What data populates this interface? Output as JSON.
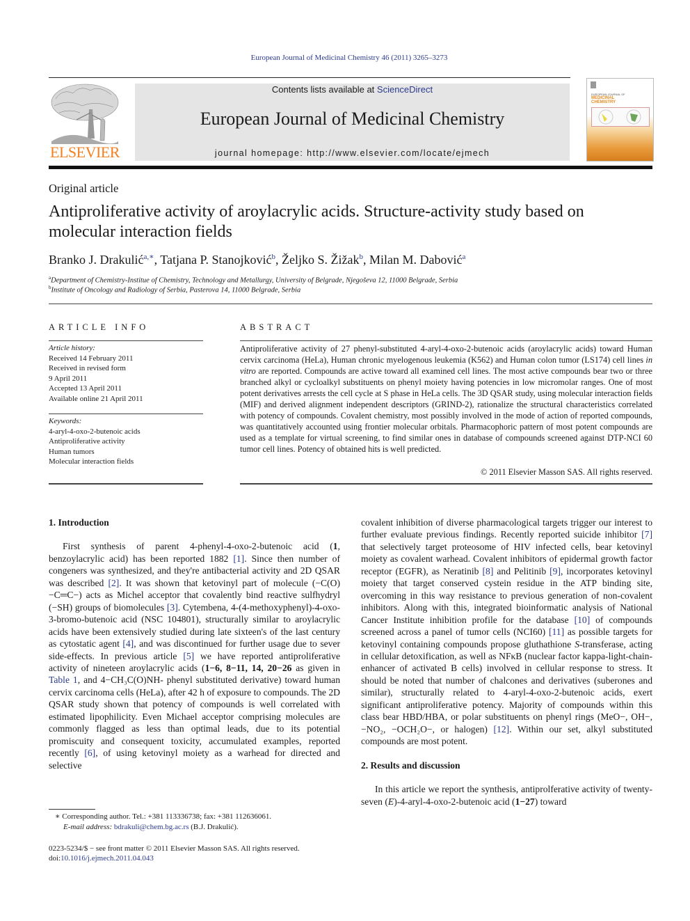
{
  "header": {
    "citation": "European Journal of Medicinal Chemistry 46 (2011) 3265–3273",
    "publisher_logo_text": "ELSEVIER",
    "contents_prefix": "Contents lists available at ",
    "contents_link": "ScienceDirect",
    "journal_title": "European Journal of Medicinal Chemistry",
    "homepage": "journal homepage: http://www.elsevier.com/locate/ejmech",
    "cover_small_text": "EUROPEAN JOURNAL OF",
    "cover_title_line1": "MEDICINAL",
    "cover_title_line2": "CHEMISTRY"
  },
  "article": {
    "type": "Original article",
    "title": "Antiproliferative activity of aroylacrylic acids. Structure-activity study based on molecular interaction fields",
    "authors": [
      {
        "name": "Branko J. Drakulić",
        "sup": "a,∗",
        "sep": ", "
      },
      {
        "name": "Tatjana P. Stanojković",
        "sup": "b",
        "sep": ", "
      },
      {
        "name": "Željko S. Žižak",
        "sup": "b",
        "sep": ", "
      },
      {
        "name": "Milan M. Dabović",
        "sup": "a",
        "sep": ""
      }
    ],
    "affiliations": [
      {
        "mark": "a",
        "text": "Department of Chemistry-Institue of Chemistry, Technology and Metallurgy, University of Belgrade, Njegoševa 12, 11000 Belgrade, Serbia"
      },
      {
        "mark": "b",
        "text": "Institute of Oncology and Radiology of Serbia, Pasterova 14, 11000 Belgrade, Serbia"
      }
    ]
  },
  "article_info": {
    "heading": "ARTICLE INFO",
    "history_label": "Article history:",
    "history": [
      "Received 14 February 2011",
      "Received in revised form",
      "9 April 2011",
      "Accepted 13 April 2011",
      "Available online 21 April 2011"
    ],
    "keywords_label": "Keywords:",
    "keywords": [
      "4-aryl-4-oxo-2-butenoic acids",
      "Antiproliferative activity",
      "Human tumors",
      "Molecular interaction fields"
    ]
  },
  "abstract": {
    "heading": "ABSTRACT",
    "text_1": "Antiproliferative activity of 27 phenyl-substituted 4-aryl-4-oxo-2-butenoic acids (aroylacrylic acids) toward Human cervix carcinoma (HeLa), Human chronic myelogenous leukemia (K562) and Human colon tumor (LS174) cell lines ",
    "text_italic": "in vitro",
    "text_2": " are reported. Compounds are active toward all examined cell lines. The most active compounds bear two or three branched alkyl or cycloalkyl substituents on phenyl moiety having potencies in low micromolar ranges. One of most potent derivatives arrests the cell cycle at S phase in HeLa cells. The 3D QSAR study, using molecular interaction fields (MIF) and derived alignment independent descriptors (GRIND-2), rationalize the structural characteristics correlated with potency of compounds. Covalent chemistry, most possibly involved in the mode of action of reported compounds, was quantitatively accounted using frontier molecular orbitals. Pharmacophoric pattern of most potent compounds are used as a template for virtual screening, to find similar ones in database of compounds screened against DTP-NCI 60 tumor cell lines. Potency of obtained hits is well predicted.",
    "copyright": "© 2011 Elsevier Masson SAS. All rights reserved."
  },
  "body": {
    "intro_heading": "1.  Introduction",
    "intro_p1_a": "First synthesis of parent 4-phenyl-4-oxo-2-butenoic acid (",
    "intro_p1_bold1": "1",
    "intro_p1_b": ", benzoylacrylic acid) has been reported 1882 ",
    "ref1": "[1]",
    "intro_p1_c": ". Since then number of congeners was synthesized, and they're antibacterial activity and 2D QSAR was described ",
    "ref2": "[2]",
    "intro_p1_d": ". It was shown that ketovinyl part of molecule (−C(O)−C═C−) acts as Michel acceptor that covalently bind reactive sulfhydryl (−SH) groups of biomolecules ",
    "ref3": "[3]",
    "intro_p1_e": ". Cytembena, 4-(4-methoxyphenyl)-4-oxo-3-bromo-butenoic acid (NSC 104801), structurally similar to aroylacrylic acids have been extensively studied during late sixteen's of the last century as cytostatic agent ",
    "ref4": "[4]",
    "intro_p1_f": ", and was discontinued for further usage due to sever side-effects. In previous article ",
    "ref5": "[5]",
    "intro_p1_g": " we have reported antiproliferative activity of nineteen aroylacrylic acids (",
    "intro_p1_bold2": "1−6, 8−11, 14, 20−26",
    "intro_p1_h": " as given in ",
    "table_ref": "Table 1",
    "intro_p1_i": ", and 4−CH₃C(O)NH- phenyl substituted derivative) toward human cervix carcinoma cells (HeLa), after 42 h of exposure to compounds. The 2D QSAR study shown that potency of compounds is well correlated with estimated lipophilicity. Even Michael acceptor comprising molecules are commonly flagged as less than optimal leads, due to its potential promiscuity and consequent toxicity, accumulated examples, reported recently ",
    "ref6": "[6]",
    "intro_p1_j": ", of using ketovinyl moiety as a warhead for directed and selective covalent inhibition of diverse pharmacological targets trigger our interest to further evaluate previous findings. Recently reported suicide inhibitor ",
    "ref7": "[7]",
    "intro_p1_k": " that selectively target proteosome of HIV infected cells, bear ketovinyl moiety as covalent warhead. Covalent inhibitors of epidermal growth factor receptor (EGFR), as Neratinib ",
    "ref8": "[8]",
    "intro_p1_l": " and Pelitinib ",
    "ref9": "[9]",
    "intro_p1_m": ", incorporates ketovinyl moiety that target conserved cystein residue in the ATP binding site, overcoming in this way resistance to previous generation of non-covalent inhibitors. Along with this, integrated bioinformatic analysis of National Cancer Institute inhibition profile for the database ",
    "ref10": "[10]",
    "intro_p1_n": " of compounds screened across a panel of tumor cells (NCI60) ",
    "ref11": "[11]",
    "intro_p1_o": " as possible targets for ketovinyl containing compounds propose gluthathione ",
    "intro_p1_italic_s": "S",
    "intro_p1_p": "-transferase, acting in cellular detoxification, as well as NFκB (nuclear factor kappa-light-chain-enhancer of activated B cells) involved in cellular response to stress. It should be noted that number of chalcones and derivatives (suberones and similar), structurally related to 4-aryl-4-oxo-2-butenoic acids, exert significant antiproliferative potency. Majority of compounds within this class bear HBD/HBA, or polar substituents on phenyl rings (MeO−, OH−, −NO₂, −OCH₂O−, or halogen) ",
    "ref12": "[12]",
    "intro_p1_q": ". Within our set, alkyl substituted compounds are most potent.",
    "results_heading": "2.  Results and discussion",
    "results_p1_a": "In this article we report the synthesis, antiprolferative activity of twenty-seven (",
    "results_p1_italic_e": "E",
    "results_p1_b": ")-4-aryl-4-oxo-2-butenoic acid (",
    "results_p1_bold": "1−27",
    "results_p1_c": ") toward"
  },
  "footnotes": {
    "corresponding": "∗  Corresponding author. Tel.: +381 113336738; fax: +381 112636061.",
    "email_label": "E-mail address:",
    "email": "bdrakuli@chem.bg.ac.rs",
    "email_suffix": " (B.J. Drakulić).",
    "issn_line": "0223-5234/$ − see front matter © 2011 Elsevier Masson SAS. All rights reserved.",
    "doi_label": "doi:",
    "doi": "10.1016/j.ejmech.2011.04.043"
  }
}
